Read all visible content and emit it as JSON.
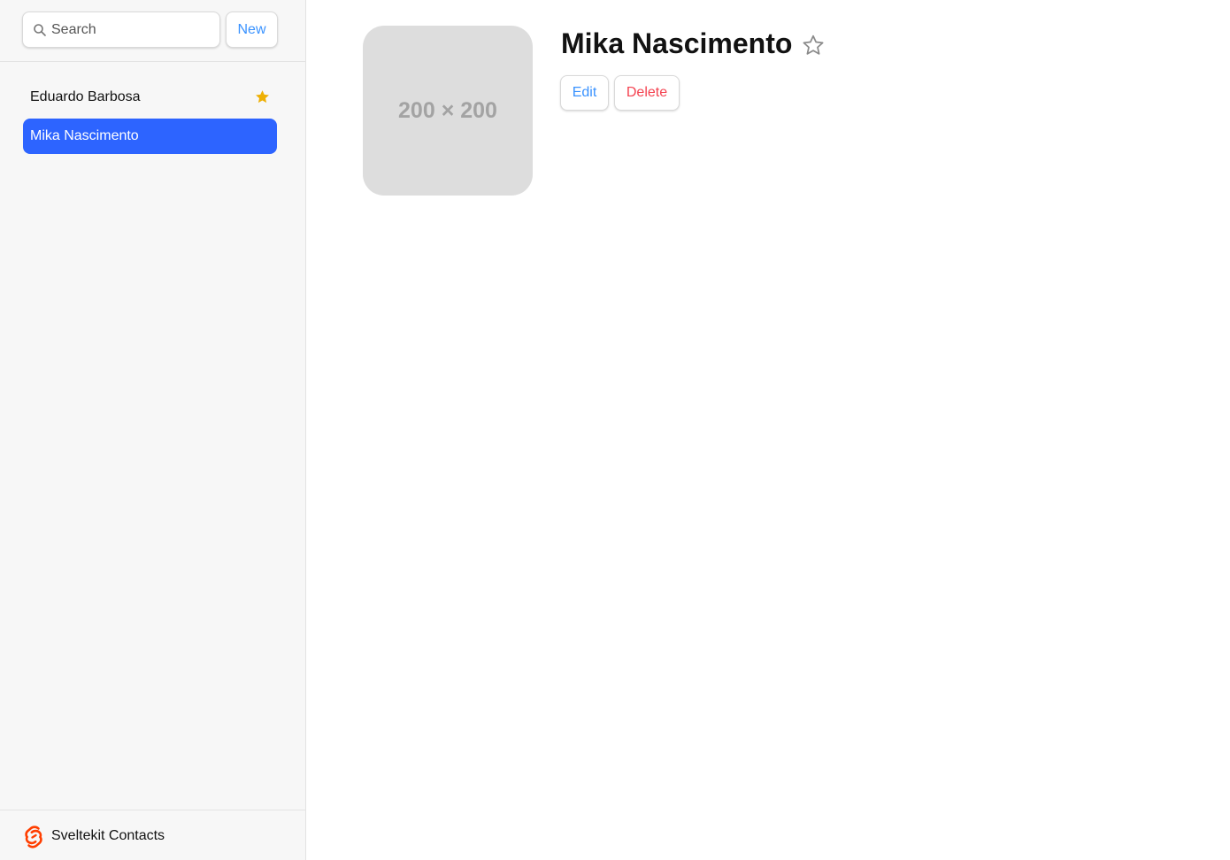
{
  "sidebar": {
    "search": {
      "placeholder": "Search",
      "value": ""
    },
    "new_label": "New",
    "contacts": [
      {
        "name": "Eduardo Barbosa",
        "favorite": true,
        "selected": false
      },
      {
        "name": "Mika Nascimento",
        "favorite": false,
        "selected": true
      }
    ],
    "footer": {
      "brand": "Sveltekit Contacts"
    }
  },
  "detail": {
    "avatar_text": "200 × 200",
    "name": "Mika Nascimento",
    "favorite": false,
    "edit_label": "Edit",
    "delete_label": "Delete"
  },
  "colors": {
    "accent": "#3992ff",
    "selected_bg": "#2d64ff",
    "danger": "#f44250",
    "star": "#eeb004",
    "brand_logo": "#ff3e00"
  }
}
